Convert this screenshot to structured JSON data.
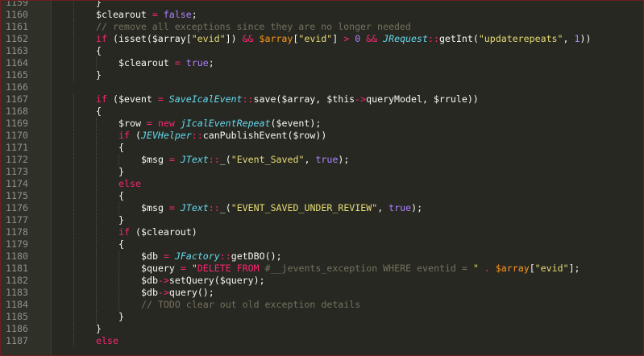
{
  "editor": {
    "lines": [
      {
        "n": "1159",
        "indent": 2,
        "tokens": [
          {
            "t": "}",
            "c": "plain"
          }
        ]
      },
      {
        "n": "1160",
        "indent": 2,
        "tokens": [
          {
            "t": "$clearout",
            "c": "plain"
          },
          {
            "t": " ",
            "c": "plain"
          },
          {
            "t": "=",
            "c": "op"
          },
          {
            "t": " ",
            "c": "plain"
          },
          {
            "t": "false",
            "c": "const"
          },
          {
            "t": ";",
            "c": "plain"
          }
        ]
      },
      {
        "n": "1161",
        "indent": 2,
        "tokens": [
          {
            "t": "// remove all exceptions since they are no longer needed",
            "c": "com"
          }
        ]
      },
      {
        "n": "1162",
        "indent": 2,
        "tokens": [
          {
            "t": "if",
            "c": "kw"
          },
          {
            "t": " (",
            "c": "plain"
          },
          {
            "t": "isset",
            "c": "fn"
          },
          {
            "t": "(",
            "c": "plain"
          },
          {
            "t": "$array",
            "c": "plain"
          },
          {
            "t": "[",
            "c": "plain"
          },
          {
            "t": "\"evid\"",
            "c": "str"
          },
          {
            "t": "])",
            "c": "plain"
          },
          {
            "t": " ",
            "c": "plain"
          },
          {
            "t": "&&",
            "c": "op"
          },
          {
            "t": " ",
            "c": "plain"
          },
          {
            "t": "$array",
            "c": "var"
          },
          {
            "t": "[",
            "c": "plain"
          },
          {
            "t": "\"evid\"",
            "c": "str"
          },
          {
            "t": "]",
            "c": "plain"
          },
          {
            "t": " ",
            "c": "plain"
          },
          {
            "t": ">",
            "c": "op"
          },
          {
            "t": " ",
            "c": "plain"
          },
          {
            "t": "0",
            "c": "num"
          },
          {
            "t": " ",
            "c": "plain"
          },
          {
            "t": "&&",
            "c": "op"
          },
          {
            "t": " ",
            "c": "plain"
          },
          {
            "t": "JRequest",
            "c": "cls"
          },
          {
            "t": "::",
            "c": "op"
          },
          {
            "t": "getInt",
            "c": "fn"
          },
          {
            "t": "(",
            "c": "plain"
          },
          {
            "t": "\"updaterepeats\"",
            "c": "str"
          },
          {
            "t": ", ",
            "c": "plain"
          },
          {
            "t": "1",
            "c": "num"
          },
          {
            "t": "))",
            "c": "plain"
          }
        ]
      },
      {
        "n": "1163",
        "indent": 2,
        "tokens": [
          {
            "t": "{",
            "c": "plain"
          }
        ]
      },
      {
        "n": "1164",
        "indent": 3,
        "tokens": [
          {
            "t": "$clearout",
            "c": "plain"
          },
          {
            "t": " ",
            "c": "plain"
          },
          {
            "t": "=",
            "c": "op"
          },
          {
            "t": " ",
            "c": "plain"
          },
          {
            "t": "true",
            "c": "const"
          },
          {
            "t": ";",
            "c": "plain"
          }
        ]
      },
      {
        "n": "1165",
        "indent": 2,
        "tokens": [
          {
            "t": "}",
            "c": "plain"
          }
        ]
      },
      {
        "n": "1166",
        "indent": 0,
        "tokens": []
      },
      {
        "n": "1167",
        "indent": 2,
        "tokens": [
          {
            "t": "if",
            "c": "kw"
          },
          {
            "t": " (",
            "c": "plain"
          },
          {
            "t": "$event",
            "c": "plain"
          },
          {
            "t": " ",
            "c": "plain"
          },
          {
            "t": "=",
            "c": "op"
          },
          {
            "t": " ",
            "c": "plain"
          },
          {
            "t": "SaveIcalEvent",
            "c": "cls"
          },
          {
            "t": "::",
            "c": "op"
          },
          {
            "t": "save",
            "c": "fn"
          },
          {
            "t": "(",
            "c": "plain"
          },
          {
            "t": "$array",
            "c": "plain"
          },
          {
            "t": ", ",
            "c": "plain"
          },
          {
            "t": "$this",
            "c": "plain"
          },
          {
            "t": "->",
            "c": "op"
          },
          {
            "t": "queryModel",
            "c": "plain"
          },
          {
            "t": ", ",
            "c": "plain"
          },
          {
            "t": "$rrule",
            "c": "plain"
          },
          {
            "t": "))",
            "c": "plain"
          }
        ]
      },
      {
        "n": "1168",
        "indent": 2,
        "tokens": [
          {
            "t": "{",
            "c": "plain"
          }
        ]
      },
      {
        "n": "1169",
        "indent": 3,
        "tokens": [
          {
            "t": "$row",
            "c": "plain"
          },
          {
            "t": " ",
            "c": "plain"
          },
          {
            "t": "=",
            "c": "op"
          },
          {
            "t": " ",
            "c": "plain"
          },
          {
            "t": "new",
            "c": "kw"
          },
          {
            "t": " ",
            "c": "plain"
          },
          {
            "t": "jIcalEventRepeat",
            "c": "cls"
          },
          {
            "t": "(",
            "c": "plain"
          },
          {
            "t": "$event",
            "c": "plain"
          },
          {
            "t": ");",
            "c": "plain"
          }
        ]
      },
      {
        "n": "1170",
        "indent": 3,
        "tokens": [
          {
            "t": "if",
            "c": "kw"
          },
          {
            "t": " (",
            "c": "plain"
          },
          {
            "t": "JEVHelper",
            "c": "cls"
          },
          {
            "t": "::",
            "c": "op"
          },
          {
            "t": "canPublishEvent",
            "c": "fn"
          },
          {
            "t": "(",
            "c": "plain"
          },
          {
            "t": "$row",
            "c": "plain"
          },
          {
            "t": "))",
            "c": "plain"
          }
        ]
      },
      {
        "n": "1171",
        "indent": 3,
        "tokens": [
          {
            "t": "{",
            "c": "plain"
          }
        ]
      },
      {
        "n": "1172",
        "indent": 4,
        "tokens": [
          {
            "t": "$msg",
            "c": "plain"
          },
          {
            "t": " ",
            "c": "plain"
          },
          {
            "t": "=",
            "c": "op"
          },
          {
            "t": " ",
            "c": "plain"
          },
          {
            "t": "JText",
            "c": "cls"
          },
          {
            "t": "::",
            "c": "op"
          },
          {
            "t": "_",
            "c": "fn"
          },
          {
            "t": "(",
            "c": "plain"
          },
          {
            "t": "\"Event_Saved\"",
            "c": "str"
          },
          {
            "t": ", ",
            "c": "plain"
          },
          {
            "t": "true",
            "c": "const"
          },
          {
            "t": ");",
            "c": "plain"
          }
        ]
      },
      {
        "n": "1173",
        "indent": 3,
        "tokens": [
          {
            "t": "}",
            "c": "plain"
          }
        ]
      },
      {
        "n": "1174",
        "indent": 3,
        "tokens": [
          {
            "t": "else",
            "c": "kw"
          }
        ]
      },
      {
        "n": "1175",
        "indent": 3,
        "tokens": [
          {
            "t": "{",
            "c": "plain"
          }
        ]
      },
      {
        "n": "1176",
        "indent": 4,
        "tokens": [
          {
            "t": "$msg",
            "c": "plain"
          },
          {
            "t": " ",
            "c": "plain"
          },
          {
            "t": "=",
            "c": "op"
          },
          {
            "t": " ",
            "c": "plain"
          },
          {
            "t": "JText",
            "c": "cls"
          },
          {
            "t": "::",
            "c": "op"
          },
          {
            "t": "_",
            "c": "fn"
          },
          {
            "t": "(",
            "c": "plain"
          },
          {
            "t": "\"EVENT_SAVED_UNDER_REVIEW\"",
            "c": "str"
          },
          {
            "t": ", ",
            "c": "plain"
          },
          {
            "t": "true",
            "c": "const"
          },
          {
            "t": ");",
            "c": "plain"
          }
        ]
      },
      {
        "n": "1177",
        "indent": 3,
        "tokens": [
          {
            "t": "}",
            "c": "plain"
          }
        ]
      },
      {
        "n": "1178",
        "indent": 3,
        "tokens": [
          {
            "t": "if",
            "c": "kw"
          },
          {
            "t": " (",
            "c": "plain"
          },
          {
            "t": "$clearout",
            "c": "plain"
          },
          {
            "t": ")",
            "c": "plain"
          }
        ]
      },
      {
        "n": "1179",
        "indent": 3,
        "tokens": [
          {
            "t": "{",
            "c": "plain"
          }
        ]
      },
      {
        "n": "1180",
        "indent": 4,
        "tokens": [
          {
            "t": "$db",
            "c": "plain"
          },
          {
            "t": " ",
            "c": "plain"
          },
          {
            "t": "=",
            "c": "op"
          },
          {
            "t": " ",
            "c": "plain"
          },
          {
            "t": "JFactory",
            "c": "cls"
          },
          {
            "t": "::",
            "c": "op"
          },
          {
            "t": "getDBO",
            "c": "fn"
          },
          {
            "t": "();",
            "c": "plain"
          }
        ]
      },
      {
        "n": "1181",
        "indent": 4,
        "tokens": [
          {
            "t": "$query",
            "c": "plain"
          },
          {
            "t": " ",
            "c": "plain"
          },
          {
            "t": "=",
            "c": "op"
          },
          {
            "t": " ",
            "c": "plain"
          },
          {
            "t": "\"",
            "c": "str"
          },
          {
            "t": "DELETE FROM",
            "c": "kw"
          },
          {
            "t": " #__jevents_exception WHERE eventid = ",
            "c": "com"
          },
          {
            "t": "\"",
            "c": "str"
          },
          {
            "t": " ",
            "c": "plain"
          },
          {
            "t": ".",
            "c": "op"
          },
          {
            "t": " ",
            "c": "plain"
          },
          {
            "t": "$array",
            "c": "var"
          },
          {
            "t": "[",
            "c": "plain"
          },
          {
            "t": "\"evid\"",
            "c": "str"
          },
          {
            "t": "];",
            "c": "plain"
          }
        ]
      },
      {
        "n": "1182",
        "indent": 4,
        "tokens": [
          {
            "t": "$db",
            "c": "plain"
          },
          {
            "t": "->",
            "c": "op"
          },
          {
            "t": "setQuery",
            "c": "fn"
          },
          {
            "t": "(",
            "c": "plain"
          },
          {
            "t": "$query",
            "c": "plain"
          },
          {
            "t": ");",
            "c": "plain"
          }
        ]
      },
      {
        "n": "1183",
        "indent": 4,
        "tokens": [
          {
            "t": "$db",
            "c": "plain"
          },
          {
            "t": "->",
            "c": "op"
          },
          {
            "t": "query",
            "c": "fn"
          },
          {
            "t": "();",
            "c": "plain"
          }
        ]
      },
      {
        "n": "1184",
        "indent": 4,
        "tokens": [
          {
            "t": "// TODO clear out old exception details",
            "c": "com"
          }
        ]
      },
      {
        "n": "1185",
        "indent": 3,
        "tokens": [
          {
            "t": "}",
            "c": "plain"
          }
        ]
      },
      {
        "n": "1186",
        "indent": 2,
        "tokens": [
          {
            "t": "}",
            "c": "plain"
          }
        ]
      },
      {
        "n": "1187",
        "indent": 2,
        "tokens": [
          {
            "t": "else",
            "c": "kw"
          }
        ]
      }
    ]
  }
}
